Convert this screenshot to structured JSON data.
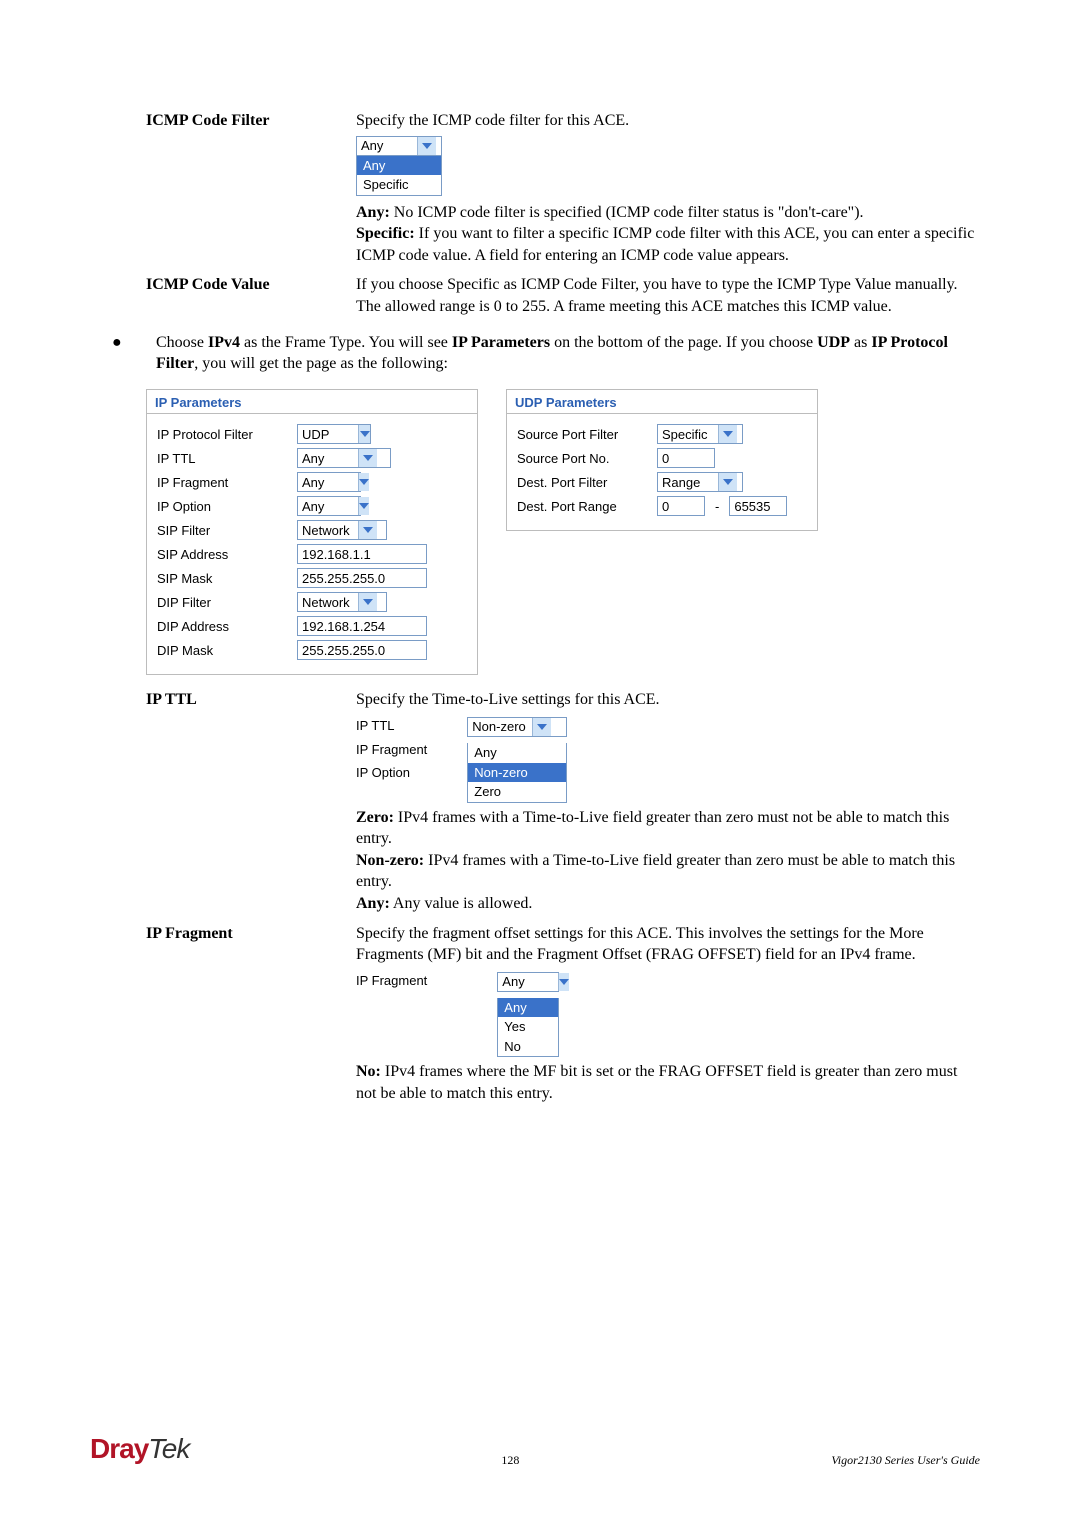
{
  "icmp": {
    "code_filter_label": "ICMP Code Filter",
    "code_filter_intro": "Specify the ICMP code filter for this ACE.",
    "sel_value": "Any",
    "opt_any": "Any",
    "opt_specific": "Specific",
    "any_desc": " No ICMP code filter is specified (ICMP code filter status is \"don't-care\").",
    "spec_desc": " If you want to filter a specific ICMP code filter with this ACE, you can enter a specific ICMP code value. A field for entering an ICMP code value appears.",
    "code_value_label": "ICMP Code Value",
    "code_value_desc": "If you choose Specific as ICMP Code Filter, you have to type the ICMP Type Value manually. The allowed range is 0 to 255. A frame meeting this ACE matches this ICMP value."
  },
  "bullet": {
    "l1a": "Choose ",
    "l1b": "IPv4",
    "l1c": " as the Frame Type. You will see ",
    "l1d": "IP Parameters",
    "l1e": " on the bottom of the page. If you choose ",
    "l1f": "UDP",
    "l1g": " as ",
    "l1h": "IP Protocol Filter",
    "l1i": ", you will get the page as the following:"
  },
  "ip_panel": {
    "title": "IP Parameters",
    "rows": {
      "proto_filter": "IP Protocol Filter",
      "proto_val": "UDP",
      "ttl": "IP TTL",
      "ttl_val": "Any",
      "frag": "IP Fragment",
      "frag_val": "Any",
      "opt": "IP Option",
      "opt_val": "Any",
      "sipf": "SIP Filter",
      "sipf_val": "Network",
      "sipa": "SIP Address",
      "sipa_val": "192.168.1.1",
      "sipm": "SIP Mask",
      "sipm_val": "255.255.255.0",
      "dipf": "DIP Filter",
      "dipf_val": "Network",
      "dipa": "DIP Address",
      "dipa_val": "192.168.1.254",
      "dipm": "DIP Mask",
      "dipm_val": "255.255.255.0"
    }
  },
  "udp_panel": {
    "title": "UDP Parameters",
    "rows": {
      "spf": "Source Port Filter",
      "spf_val": "Specific",
      "spn": "Source Port No.",
      "spn_val": "0",
      "dpf": "Dest. Port Filter",
      "dpf_val": "Range",
      "dpr": "Dest. Port Range",
      "dpr_lo": "0",
      "dpr_hi": "65535"
    }
  },
  "ipttl": {
    "label": "IP TTL",
    "intro": "Specify the Time-to-Live settings for this ACE.",
    "row_ttl": "IP TTL",
    "row_frag": "IP Fragment",
    "row_opt": "IP Option",
    "sel_val": "Non-zero",
    "opt_any": "Any",
    "opt_nz": "Non-zero",
    "opt_z": "Zero",
    "zero_lbl": "Zero:",
    "zero_txt": " IPv4 frames with a Time-to-Live field greater than zero must not be able to match this entry.",
    "nz_lbl": "Non-zero:",
    "nz_txt": " IPv4 frames with a Time-to-Live field greater than zero must be able to match this entry.",
    "any_lbl": "Any:",
    "any_txt": " Any value is allowed."
  },
  "ipfrag": {
    "label": "IP Fragment",
    "intro": "Specify the fragment offset settings for this ACE. This involves the settings for the More Fragments (MF) bit and the Fragment Offset (FRAG OFFSET) field for an IPv4 frame.",
    "row_frag": "IP Fragment",
    "sel_val": "Any",
    "opt_any": "Any",
    "opt_yes": "Yes",
    "opt_no": "No",
    "no_lbl": "No:",
    "no_txt": " IPv4 frames where the MF bit is set or the FRAG OFFSET field is greater than zero must not be able to match this entry."
  },
  "footer": {
    "logo1": "Dray",
    "logo2": "Tek",
    "page": "128",
    "guide": "Vigor2130 Series User's Guide"
  }
}
